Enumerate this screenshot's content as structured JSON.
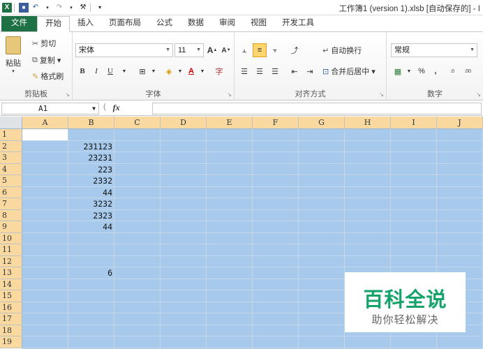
{
  "title_bar": {
    "window_title": "工作簿1 (version 1).xlsb [自动保存的] - I"
  },
  "tabs": [
    "文件",
    "开始",
    "插入",
    "页面布局",
    "公式",
    "数据",
    "审阅",
    "视图",
    "开发工具"
  ],
  "ribbon": {
    "clipboard": {
      "paste": "粘贴",
      "cut": "剪切",
      "copy": "复制 ▾",
      "format_painter": "格式刷",
      "label": "剪贴板"
    },
    "font": {
      "name": "宋体",
      "size": "11",
      "label": "字体",
      "bold": "B",
      "italic": "I",
      "underline": "U",
      "grow": "A",
      "shrink": "A"
    },
    "alignment": {
      "wrap": "自动换行",
      "merge": "合并后居中 ▾",
      "label": "对齐方式"
    },
    "number": {
      "format": "常规",
      "percent": "%",
      "comma": ",",
      "inc_dec": ".0",
      "dec_dec": ".00",
      "label": "数字"
    }
  },
  "formula_bar": {
    "name_box": "A1",
    "fx": "fx"
  },
  "sheet": {
    "columns": [
      "A",
      "B",
      "C",
      "D",
      "E",
      "F",
      "G",
      "H",
      "I",
      "J"
    ],
    "rows": [
      "1",
      "2",
      "3",
      "4",
      "5",
      "6",
      "7",
      "8",
      "9",
      "10",
      "11",
      "12",
      "13",
      "14",
      "15",
      "16",
      "17",
      "18",
      "19"
    ],
    "column_b_values": {
      "2": "231123",
      "3": "23231",
      "4": "223",
      "5": "2332",
      "6": "44",
      "7": "3232",
      "8": "2323",
      "9": "44",
      "13": "6"
    },
    "selection_color": "#a6c9ec"
  },
  "watermark": {
    "title": "百科全说",
    "subtitle": "助你轻松解决",
    "color": "#15a36b"
  }
}
